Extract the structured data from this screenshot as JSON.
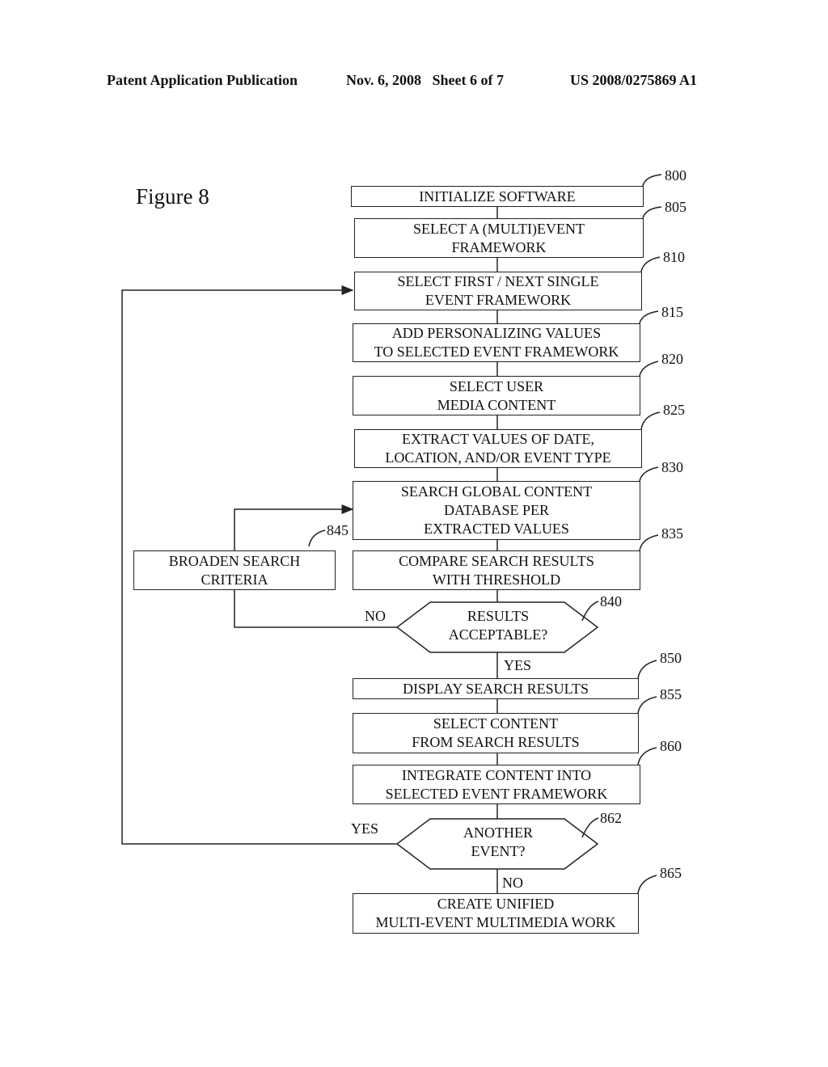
{
  "header": {
    "publication": "Patent Application Publication",
    "date_sheet": "Nov. 6, 2008   Sheet 6 of 7",
    "patent_number": "US 2008/0275869 A1"
  },
  "figure_title": "Figure 8",
  "steps": [
    {
      "ref": "800",
      "lines": [
        "INITIALIZE SOFTWARE"
      ]
    },
    {
      "ref": "805",
      "lines": [
        "SELECT A (MULTI)EVENT",
        "FRAMEWORK"
      ]
    },
    {
      "ref": "810",
      "lines": [
        "SELECT FIRST / NEXT SINGLE",
        "EVENT FRAMEWORK"
      ]
    },
    {
      "ref": "815",
      "lines": [
        "ADD PERSONALIZING VALUES",
        "TO SELECTED EVENT FRAMEWORK"
      ]
    },
    {
      "ref": "820",
      "lines": [
        "SELECT USER",
        "MEDIA CONTENT"
      ]
    },
    {
      "ref": "825",
      "lines": [
        "EXTRACT VALUES OF DATE,",
        "LOCATION, AND/OR EVENT TYPE"
      ]
    },
    {
      "ref": "830",
      "lines": [
        "SEARCH GLOBAL CONTENT",
        "DATABASE PER",
        "EXTRACTED VALUES"
      ]
    },
    {
      "ref": "835",
      "lines": [
        "COMPARE SEARCH RESULTS",
        "WITH THRESHOLD"
      ]
    },
    {
      "ref": "845",
      "lines": [
        "BROADEN SEARCH",
        "CRITERIA"
      ]
    },
    {
      "ref": "850",
      "lines": [
        "DISPLAY SEARCH RESULTS"
      ]
    },
    {
      "ref": "855",
      "lines": [
        "SELECT CONTENT",
        "FROM SEARCH RESULTS"
      ]
    },
    {
      "ref": "860",
      "lines": [
        "INTEGRATE CONTENT INTO",
        "SELECTED EVENT FRAMEWORK"
      ]
    },
    {
      "ref": "865",
      "lines": [
        "CREATE UNIFIED",
        "MULTI-EVENT MULTIMEDIA WORK"
      ]
    }
  ],
  "decisions": [
    {
      "ref": "840",
      "lines": [
        "RESULTS",
        "ACCEPTABLE?"
      ],
      "yes": "YES",
      "no": "NO"
    },
    {
      "ref": "862",
      "lines": [
        "ANOTHER",
        "EVENT?"
      ],
      "yes": "YES",
      "no": "NO"
    }
  ]
}
